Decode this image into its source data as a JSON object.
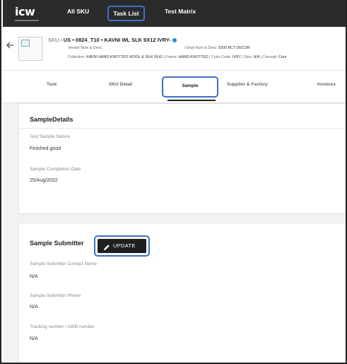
{
  "topbar": {
    "logo_text": "icw",
    "nav": {
      "all_sku": "All SKU",
      "task_list": "Task List",
      "test_matrix": "Test Matrix"
    }
  },
  "sku": {
    "prefix": "SKU / ",
    "title": "US • 0824_T10 • KAVNI WL SLK 9X12 IVRY-",
    "vendor_label": "Vendor Num & Desc:",
    "dept_label": "| Dept Num & Desc:",
    "dept_value": "8200 BCT DECOR",
    "collection_label": "Collection:",
    "collection_value": "KAVNI HAND-KNOTTED WOOL & SILK RUG",
    "frame_label": "| Frame:",
    "frame_value": "HAND-KNOTTED",
    "color_label": "| Color Code:",
    "color_value": "IVRY",
    "size_label": "| Size:",
    "size_value": "N/A",
    "concept_label": "| Concept:",
    "concept_value": "Core"
  },
  "tabs": {
    "task": "Task",
    "sku_detail": "SKU Detail",
    "sample": "Sample",
    "supplier_factory": "Supplier & Factory",
    "invoices": "Invoices"
  },
  "sample_details": {
    "title": "SampleDetails",
    "nature_label": "Test Sample Nature",
    "nature_value": "Finished good",
    "completion_label": "Sample Completion Date",
    "completion_value": "25/Aug/2022"
  },
  "sample_submitter": {
    "title": "Sample Submitter",
    "update_label": "UPDATE",
    "contact_label": "Sample Submitter Contact Name",
    "contact_value": "N/A",
    "phone_label": "Sample Submitter Phone",
    "phone_value": "N/A",
    "tracking_label": "Tracking number / AWB number",
    "tracking_value": "N/A"
  },
  "colors": {
    "topbar_bg": "#2b2b2b",
    "highlight": "#3d6fc7",
    "status_dot": "#1c8fe0"
  }
}
